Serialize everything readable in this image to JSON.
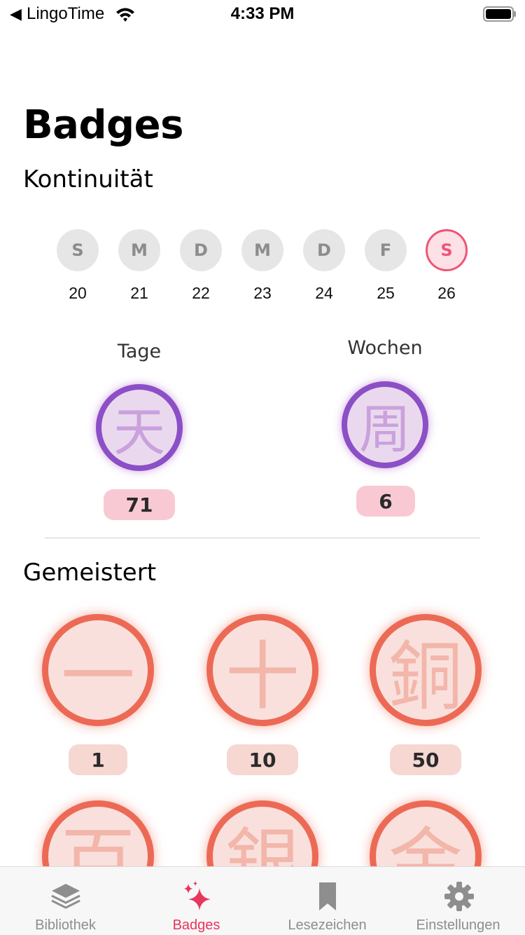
{
  "status_bar": {
    "back_glyph": "◀",
    "carrier": "LingoTime",
    "time": "4:33 PM",
    "wifi_icon": "wifi-icon",
    "battery_icon": "battery-icon"
  },
  "title": "Badges",
  "streak": {
    "title": "Kontinuität",
    "days": [
      {
        "letter": "S",
        "date": "20",
        "today": false
      },
      {
        "letter": "M",
        "date": "21",
        "today": false
      },
      {
        "letter": "D",
        "date": "22",
        "today": false
      },
      {
        "letter": "M",
        "date": "23",
        "today": false
      },
      {
        "letter": "D",
        "date": "24",
        "today": false
      },
      {
        "letter": "F",
        "date": "25",
        "today": false
      },
      {
        "letter": "S",
        "date": "26",
        "today": true
      }
    ],
    "days_label": "Tage",
    "days_glyph": "天",
    "days_count": "71",
    "weeks_label": "Wochen",
    "weeks_glyph": "周",
    "weeks_count": "6"
  },
  "mastered": {
    "title": "Gemeistert",
    "badges": [
      {
        "glyph": "一",
        "count": "1"
      },
      {
        "glyph": "十",
        "count": "10"
      },
      {
        "glyph": "銅",
        "count": "50"
      },
      {
        "glyph": "百",
        "count": ""
      },
      {
        "glyph": "銀",
        "count": ""
      },
      {
        "glyph": "金",
        "count": ""
      }
    ]
  },
  "tabs": [
    {
      "label": "Bibliothek",
      "icon": "layers-icon",
      "active": false
    },
    {
      "label": "Badges",
      "icon": "sparkles-icon",
      "active": true
    },
    {
      "label": "Lesezeichen",
      "icon": "bookmark-icon",
      "active": false
    },
    {
      "label": "Einstellungen",
      "icon": "gear-icon",
      "active": false
    }
  ],
  "colors": {
    "accent": "#e8365d",
    "today_ring": "#ee5577",
    "purple_ring": "#8b4fc6",
    "orange_ring": "#ec6a55"
  }
}
